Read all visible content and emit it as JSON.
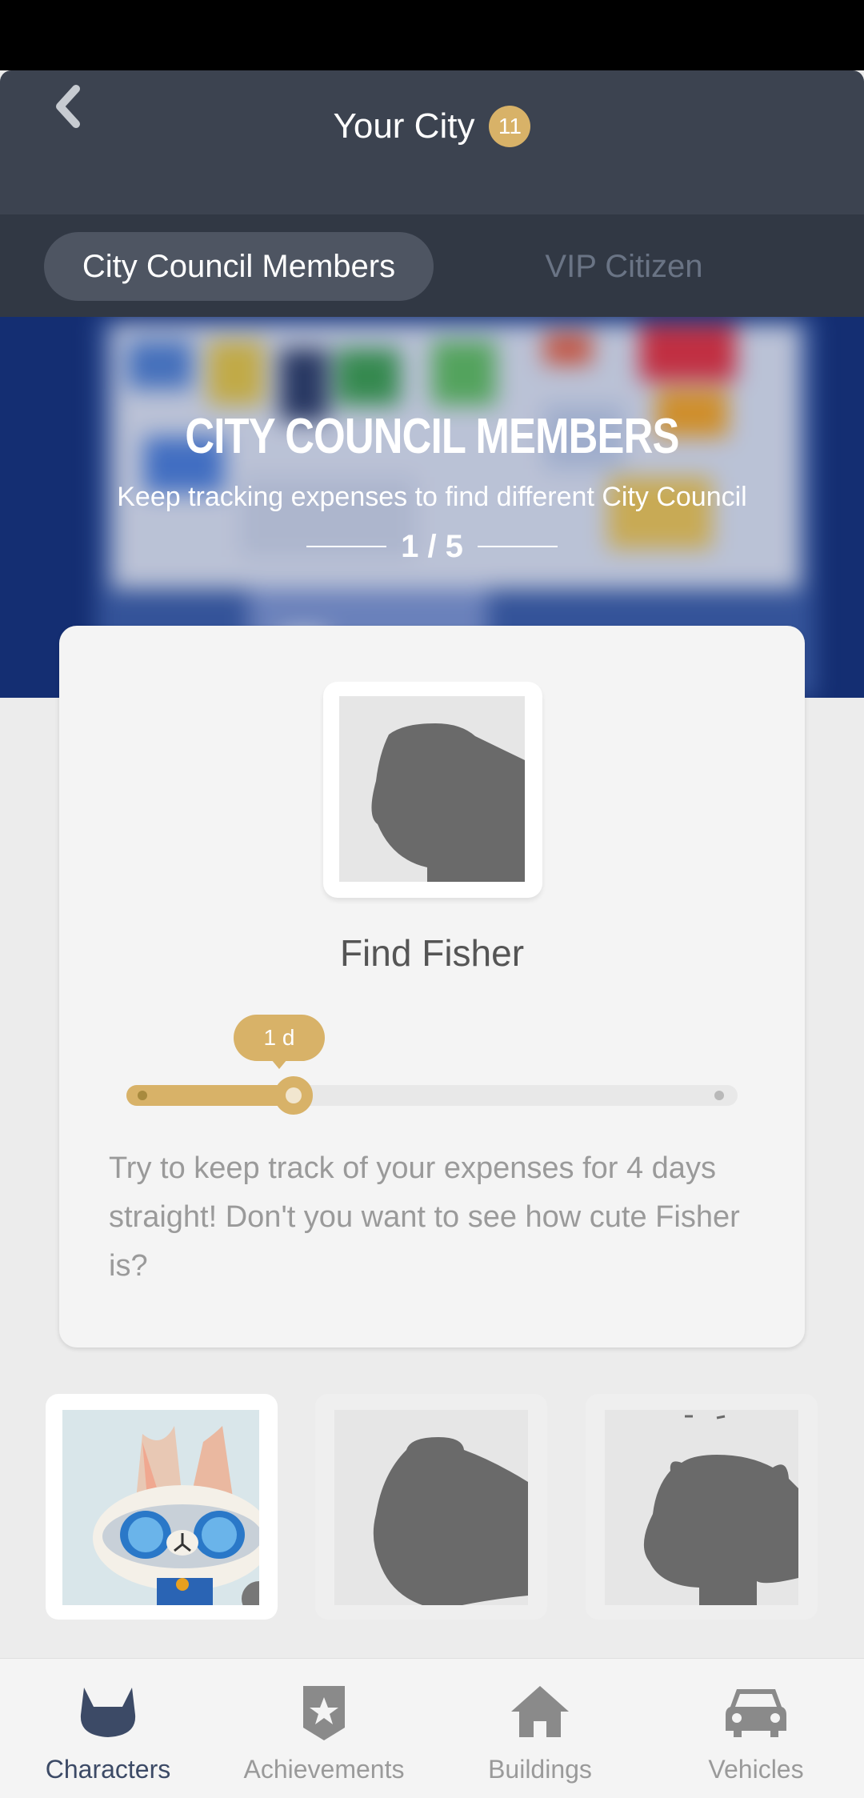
{
  "header": {
    "title": "Your City",
    "badge_count": "11"
  },
  "tabs": [
    {
      "label": "City Council Members",
      "active": true
    },
    {
      "label": "VIP Citizen",
      "active": false
    }
  ],
  "banner": {
    "heading": "CITY COUNCIL MEMBERS",
    "subtitle": "Keep tracking expenses to find different City Council",
    "counter": "1 / 5"
  },
  "card": {
    "name": "Find Fisher",
    "progress_label": "1 d",
    "progress": {
      "current": 1,
      "total": 4,
      "unit": "days"
    },
    "description": "Try to keep track of your expenses for 4 days straight! Don't you want to see how cute Fisher is?"
  },
  "thumbnails": [
    {
      "icon": "cat-character-icon",
      "state": "unlocked",
      "selected": true
    },
    {
      "icon": "locked-silhouette-icon",
      "state": "locked",
      "selected": false
    },
    {
      "icon": "locked-silhouette-icon",
      "state": "locked",
      "selected": false
    }
  ],
  "bottom_nav": [
    {
      "label": "Characters",
      "icon": "cat-icon",
      "active": true
    },
    {
      "label": "Achievements",
      "icon": "star-badge-icon",
      "active": false
    },
    {
      "label": "Buildings",
      "icon": "house-icon",
      "active": false
    },
    {
      "label": "Vehicles",
      "icon": "car-icon",
      "active": false
    }
  ],
  "colors": {
    "accent_gold": "#d8b268",
    "header_bg": "#3c4350",
    "tabbar_bg": "#313844",
    "banner_bg": "#142e72",
    "active_nav": "#3c4a66"
  }
}
